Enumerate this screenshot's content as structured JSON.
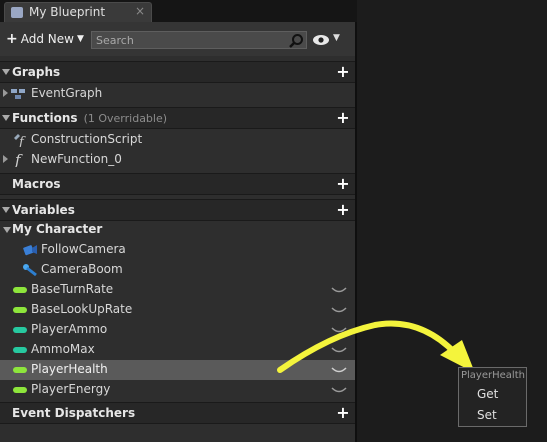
{
  "tab": {
    "title": "My Blueprint",
    "close": "×"
  },
  "toolbar": {
    "add_new": "Add New",
    "search_placeholder": "Search"
  },
  "sections": {
    "graphs": "Graphs",
    "functions": "Functions",
    "functions_note": "(1 Overridable)",
    "macros": "Macros",
    "variables": "Variables",
    "event_dispatchers": "Event Dispatchers"
  },
  "graphs": [
    {
      "label": "EventGraph",
      "icon": "event-graph-icon"
    }
  ],
  "functions": [
    {
      "label": "ConstructionScript",
      "icon": "construction-function-icon"
    },
    {
      "label": "NewFunction_0",
      "icon": "function-icon"
    }
  ],
  "variables": {
    "category": "My Character",
    "components": [
      {
        "label": "FollowCamera",
        "icon": "camera-icon"
      },
      {
        "label": "CameraBoom",
        "icon": "spring-arm-icon"
      }
    ],
    "items": [
      {
        "label": "BaseTurnRate",
        "color": "#8ee63c"
      },
      {
        "label": "BaseLookUpRate",
        "color": "#8ee63c"
      },
      {
        "label": "PlayerAmmo",
        "color": "#27c9a0"
      },
      {
        "label": "AmmoMax",
        "color": "#27c9a0"
      },
      {
        "label": "PlayerHealth",
        "color": "#8ee63c"
      },
      {
        "label": "PlayerEnergy",
        "color": "#8ee63c"
      }
    ]
  },
  "context_menu": {
    "title": "PlayerHealth",
    "items": [
      "Get",
      "Set"
    ]
  },
  "colors": {
    "arrow": "#f4f43c",
    "selected_row": "#5a5a5a"
  }
}
